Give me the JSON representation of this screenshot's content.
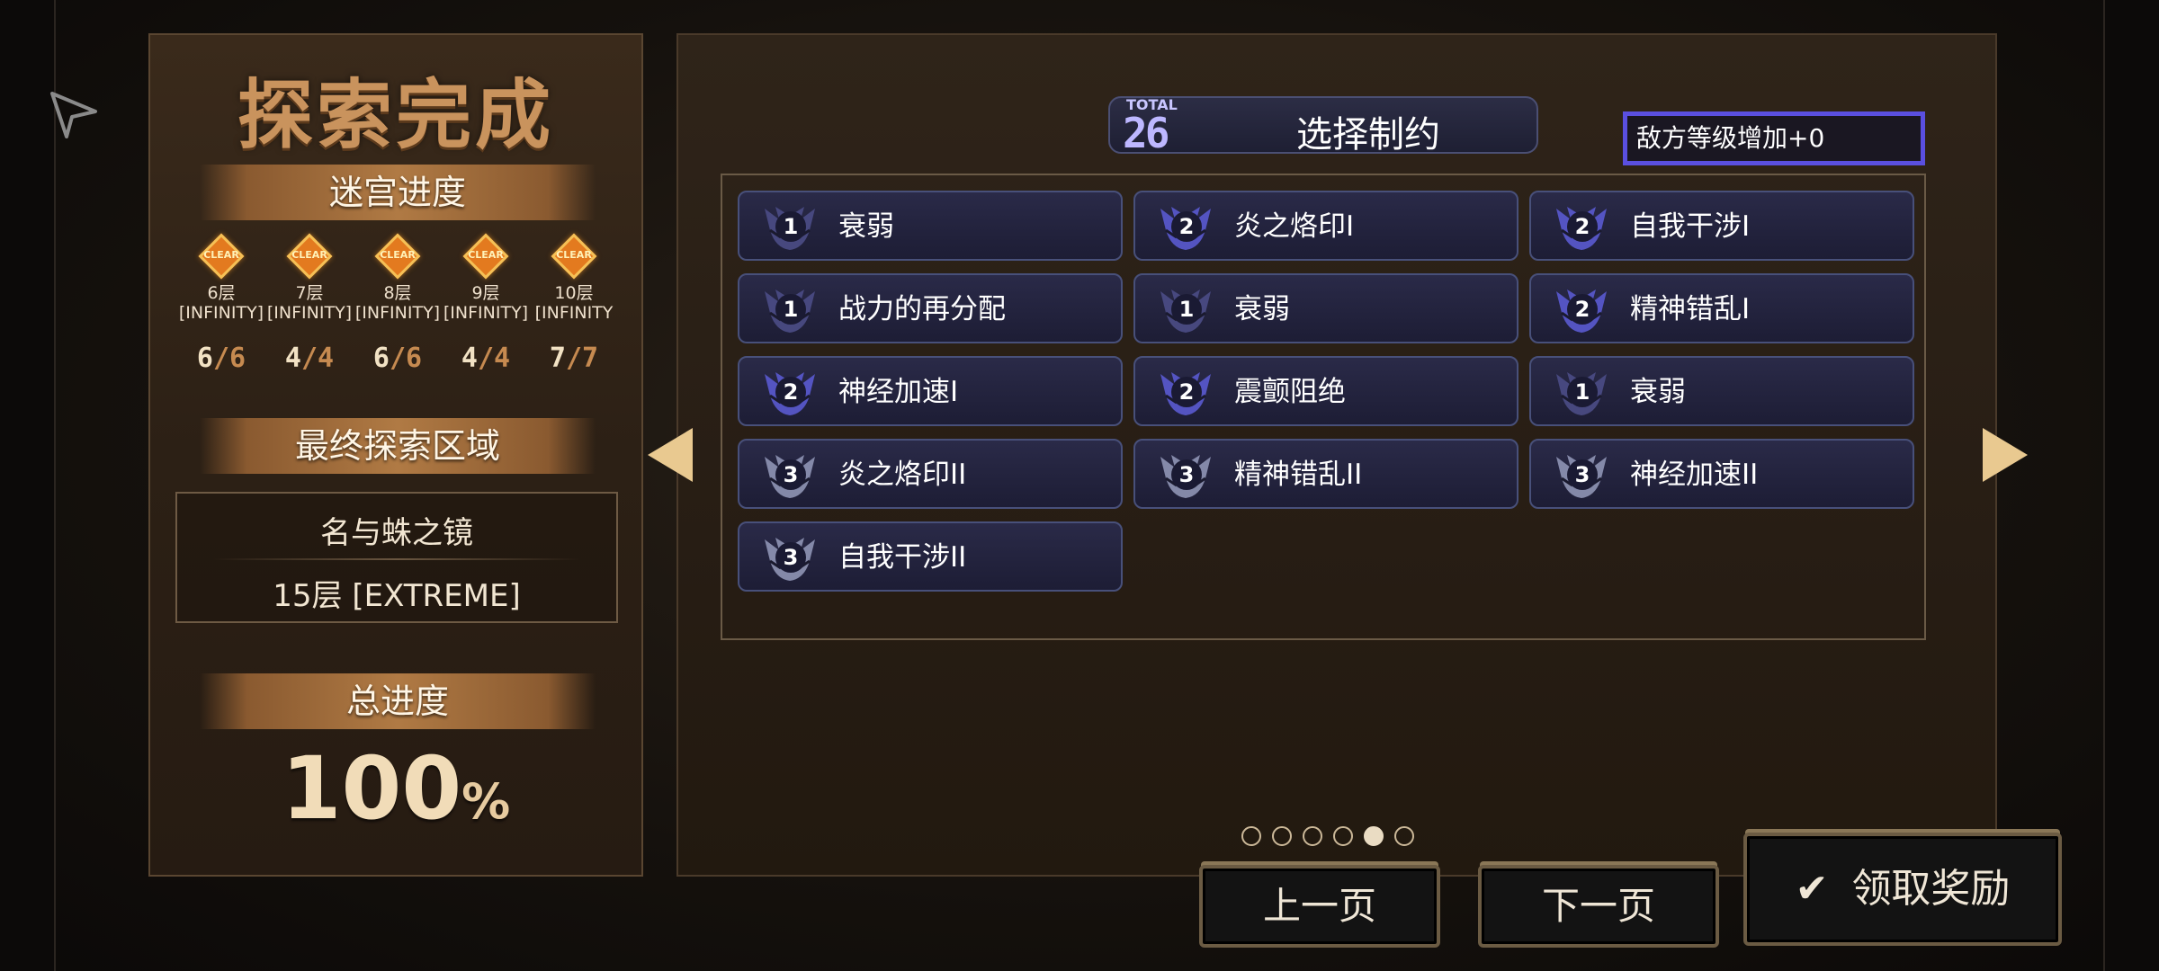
{
  "left": {
    "title": "探索完成",
    "maze_progress_label": "迷宫进度",
    "floors": [
      {
        "badge": "CLEAR",
        "name": "6层",
        "difficulty": "[INFINITY]",
        "cleared": "6",
        "total": "/6"
      },
      {
        "badge": "CLEAR",
        "name": "7层",
        "difficulty": "[INFINITY]",
        "cleared": "4",
        "total": "/4"
      },
      {
        "badge": "CLEAR",
        "name": "8层",
        "difficulty": "[INFINITY]",
        "cleared": "6",
        "total": "/6"
      },
      {
        "badge": "CLEAR",
        "name": "9层",
        "difficulty": "[INFINITY]",
        "cleared": "4",
        "total": "/4"
      },
      {
        "badge": "CLEAR",
        "name": "10层",
        "difficulty": "[INFINITY",
        "cleared": "7",
        "total": "/7"
      }
    ],
    "final_area_label": "最终探索区域",
    "final_area_name": "名与蛛之镜",
    "final_area_floor": "15层 [EXTREME]",
    "total_progress_label": "总进度",
    "total_progress_value": "100",
    "total_progress_unit": "%"
  },
  "right": {
    "total_label": "TOTAL",
    "total_value": "26",
    "constraint_title": "选择制约",
    "enemy_level_text": "敌方等级增加+0",
    "cards": [
      {
        "level": "1",
        "name": "衰弱"
      },
      {
        "level": "2",
        "name": "炎之烙印I"
      },
      {
        "level": "2",
        "name": "自我干涉I"
      },
      {
        "level": "1",
        "name": "战力的再分配"
      },
      {
        "level": "1",
        "name": "衰弱"
      },
      {
        "level": "2",
        "name": "精神错乱I"
      },
      {
        "level": "2",
        "name": "神经加速I"
      },
      {
        "level": "2",
        "name": "震颤阻绝"
      },
      {
        "level": "1",
        "name": "衰弱"
      },
      {
        "level": "3",
        "name": "炎之烙印II"
      },
      {
        "level": "3",
        "name": "精神错乱II"
      },
      {
        "level": "3",
        "name": "神经加速II"
      },
      {
        "level": "3",
        "name": "自我干涉II"
      }
    ],
    "pages_total": 6,
    "page_current": 5
  },
  "buttons": {
    "prev": "上一页",
    "next": "下一页",
    "claim": "领取奖励"
  },
  "colors": {
    "level1": "#4b4d86",
    "level2": "#5a5ad0",
    "level3": "#8f95b5",
    "accent": "#5a4fe0"
  }
}
